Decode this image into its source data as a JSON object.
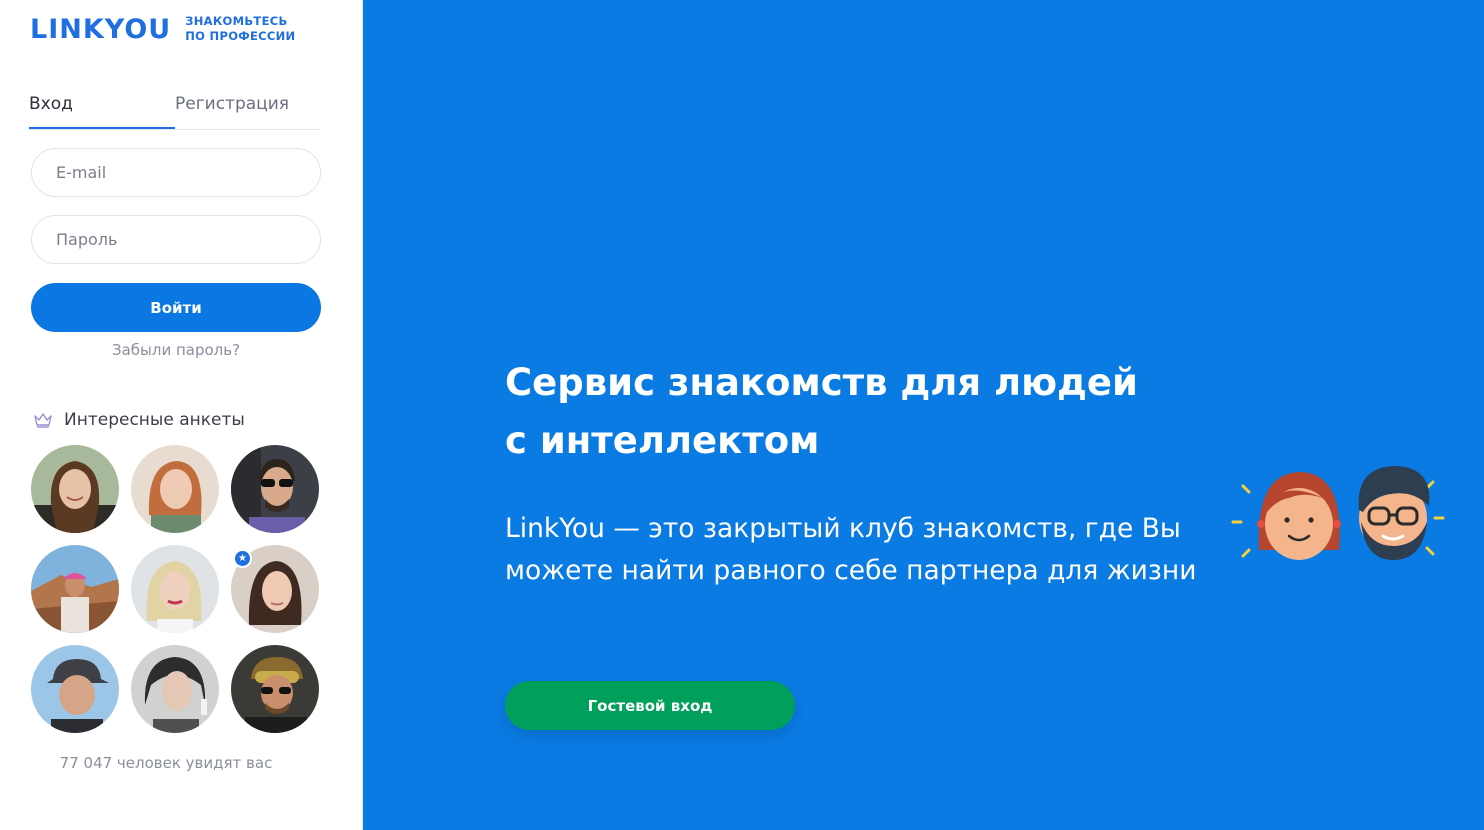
{
  "logo": {
    "word": "LINKYOU",
    "tagline_line1": "ЗНАКОМЬТЕСЬ",
    "tagline_line2": "ПО ПРОФЕССИИ",
    "color": "#1f6fe0"
  },
  "tabs": [
    {
      "label": "Вход",
      "active": true
    },
    {
      "label": "Регистрация",
      "active": false
    }
  ],
  "form": {
    "email_placeholder": "E-mail",
    "password_placeholder": "Пароль",
    "login_label": "Войти",
    "forgot_label": "Забыли пароль?"
  },
  "interesting": {
    "icon": "crown-icon",
    "label": "Интересные анкеты"
  },
  "profiles": [
    {
      "id": "profile-1",
      "photo": "woman-long-brown-hair"
    },
    {
      "id": "profile-2",
      "photo": "woman-red-hair"
    },
    {
      "id": "profile-3",
      "photo": "man-sunglasses-car"
    },
    {
      "id": "profile-4",
      "photo": "person-desert-cap"
    },
    {
      "id": "profile-5",
      "photo": "woman-blonde"
    },
    {
      "id": "profile-6",
      "photo": "woman-dark-hair",
      "featured": true
    },
    {
      "id": "profile-7",
      "photo": "man-cap"
    },
    {
      "id": "profile-8",
      "photo": "woman-dark-hair-portrait"
    },
    {
      "id": "profile-9",
      "photo": "man-goggles"
    }
  ],
  "viewers_text": "77 047 человек увидят вас",
  "hero": {
    "title_line1": "Сервис знакомств для людей",
    "title_line2": "с интеллектом",
    "description": "LinkYou — это закрытый клуб знакомств, где Вы можете найти равного себе партнера для жизни",
    "guest_label": "Гостевой вход",
    "background": "#0a7be3",
    "guest_color": "#00a05c"
  }
}
